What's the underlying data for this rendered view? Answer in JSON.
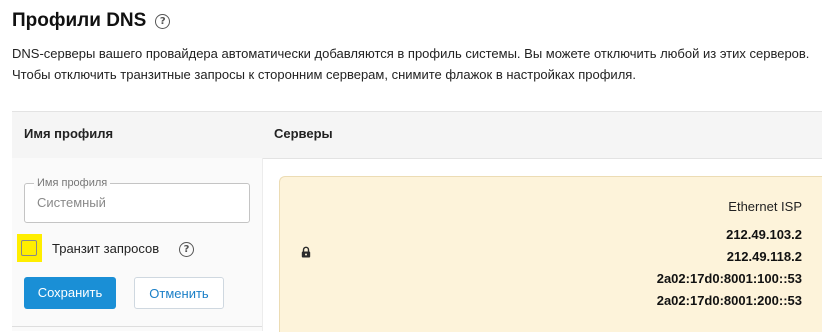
{
  "page": {
    "title": "Профили DNS",
    "help_glyph": "?",
    "description_line1": "DNS-серверы вашего провайдера автоматически добавляются в профиль системы. Вы можете отключить любой из этих серверов.",
    "description_line2": "Чтобы отключить транзитные запросы к сторонним серверам, снимите флажок в настройках профиля."
  },
  "table": {
    "col_profile": "Имя профиля",
    "col_servers": "Серверы"
  },
  "form": {
    "field_legend": "Имя профиля",
    "field_value": "Системный",
    "transit_label": "Транзит запросов",
    "transit_checked": false,
    "save_label": "Сохранить",
    "cancel_label": "Отменить"
  },
  "servers": {
    "provider": "Ethernet ISP",
    "list": [
      "212.49.103.2",
      "212.49.118.2",
      "2a02:17d0:8001:100::53",
      "2a02:17d0:8001:200::53"
    ]
  },
  "colors": {
    "primary": "#1a8fd6",
    "card_bg": "#fdf3da",
    "highlight": "#ffee00"
  },
  "icons": {
    "help": "question-circle-icon",
    "lock": "lock-icon"
  }
}
